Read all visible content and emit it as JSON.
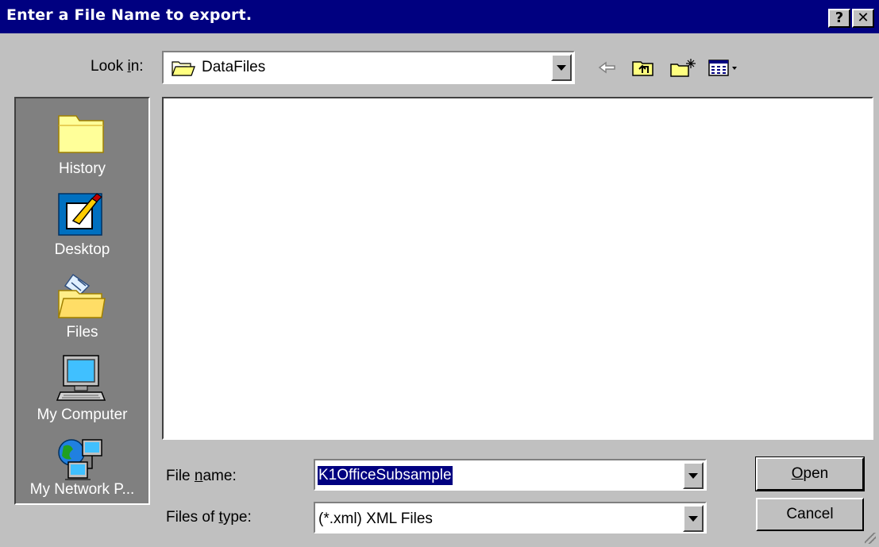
{
  "window": {
    "title": "Enter a File Name to export.",
    "help_label": "?",
    "close_label": "✕"
  },
  "lookin": {
    "label_pre": "Look ",
    "label_mn": "i",
    "label_post": "n:",
    "value": "DataFiles",
    "icon": "folder-icon"
  },
  "toolbar": {
    "icons": [
      "back-arrow-icon",
      "up-one-level-icon",
      "create-new-folder-icon",
      "view-menu-icon"
    ]
  },
  "places": [
    {
      "label": "History",
      "icon": "history-folder-icon"
    },
    {
      "label": "Desktop",
      "icon": "desktop-icon"
    },
    {
      "label": "Files",
      "icon": "files-folder-icon"
    },
    {
      "label": "My Computer",
      "icon": "my-computer-icon"
    },
    {
      "label": "My Network P...",
      "icon": "network-places-icon"
    }
  ],
  "filename": {
    "label_pre": "File ",
    "label_mn": "n",
    "label_post": "ame:",
    "value": "K1OfficeSubsample"
  },
  "filetype": {
    "label_pre": "Files of ",
    "label_mn": "t",
    "label_post": "ype:",
    "value": "(*.xml) XML Files"
  },
  "buttons": {
    "open_mn": "O",
    "open_rest": "pen",
    "cancel": "Cancel"
  }
}
